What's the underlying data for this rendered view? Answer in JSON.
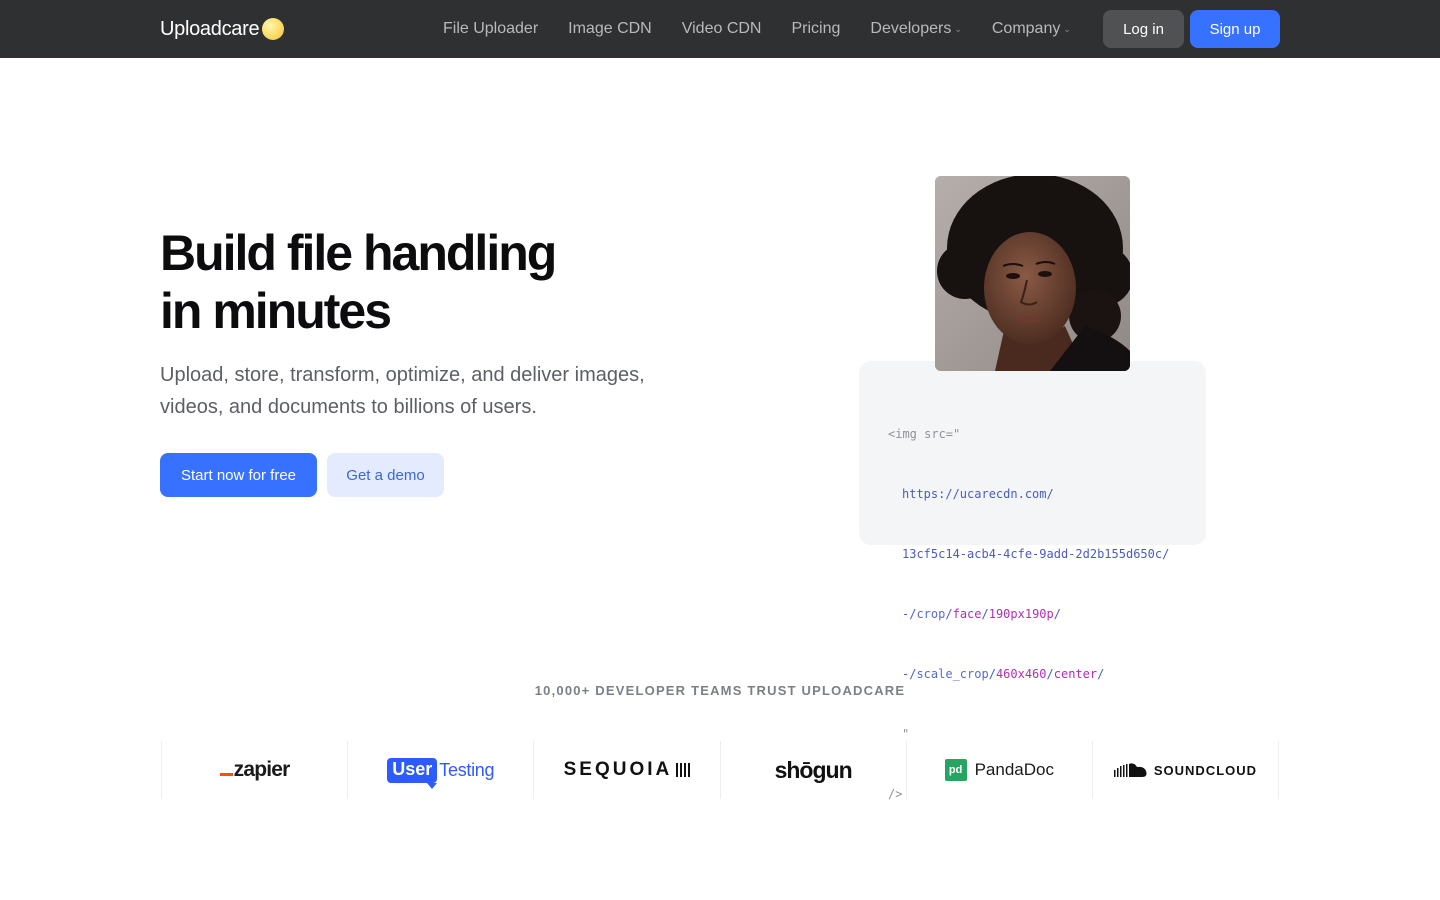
{
  "nav": {
    "logo_text": "Uploadcare",
    "links": [
      {
        "label": "File Uploader"
      },
      {
        "label": "Image CDN"
      },
      {
        "label": "Video CDN"
      },
      {
        "label": "Pricing"
      },
      {
        "label": "Developers",
        "dropdown": true
      },
      {
        "label": "Company",
        "dropdown": true
      }
    ],
    "login_label": "Log in",
    "signup_label": "Sign up"
  },
  "hero": {
    "title_line1": "Build file handling",
    "title_line2": "in minutes",
    "subtitle": "Upload, store, transform, optimize, and deliver images, videos, and documents to billions of users.",
    "start_label": "Start now for free",
    "demo_label": "Get a demo"
  },
  "code": {
    "open": "<img src=\"",
    "url": "https://ucarecdn.com/",
    "uuid": "13cf5c14-acb4-4cfe-9add-2d2b155d650c/",
    "line3_prefix": "-/",
    "line3_op": "crop",
    "line3_sep": "/",
    "line3_arg1": "face",
    "line3_sep2": "/",
    "line3_arg2": "190px190p",
    "line3_end": "/",
    "line4_prefix": "-/",
    "line4_op": "scale_crop",
    "line4_sep": "/",
    "line4_arg1": "460x460",
    "line4_sep2": "/",
    "line4_arg2": "center",
    "line4_end": "/",
    "quote": "\"",
    "close": "/>"
  },
  "trust": {
    "heading": "10,000+ DEVELOPER TEAMS TRUST UPLOADCARE",
    "logos": {
      "zapier": "zapier",
      "usertesting_user": "User",
      "usertesting_testing": "Testing",
      "sequoia": "SEQUOIA",
      "shogun": "shōgun",
      "pandadoc": "PandaDoc",
      "pandadoc_mark": "pd",
      "soundcloud": "SOUNDCLOUD"
    }
  },
  "colors": {
    "nav_bg": "#2f3031",
    "accent": "#3771ff",
    "demo_bg": "#e4ebff",
    "code_bg": "#f4f5f7",
    "code_value": "#b02fb5"
  }
}
